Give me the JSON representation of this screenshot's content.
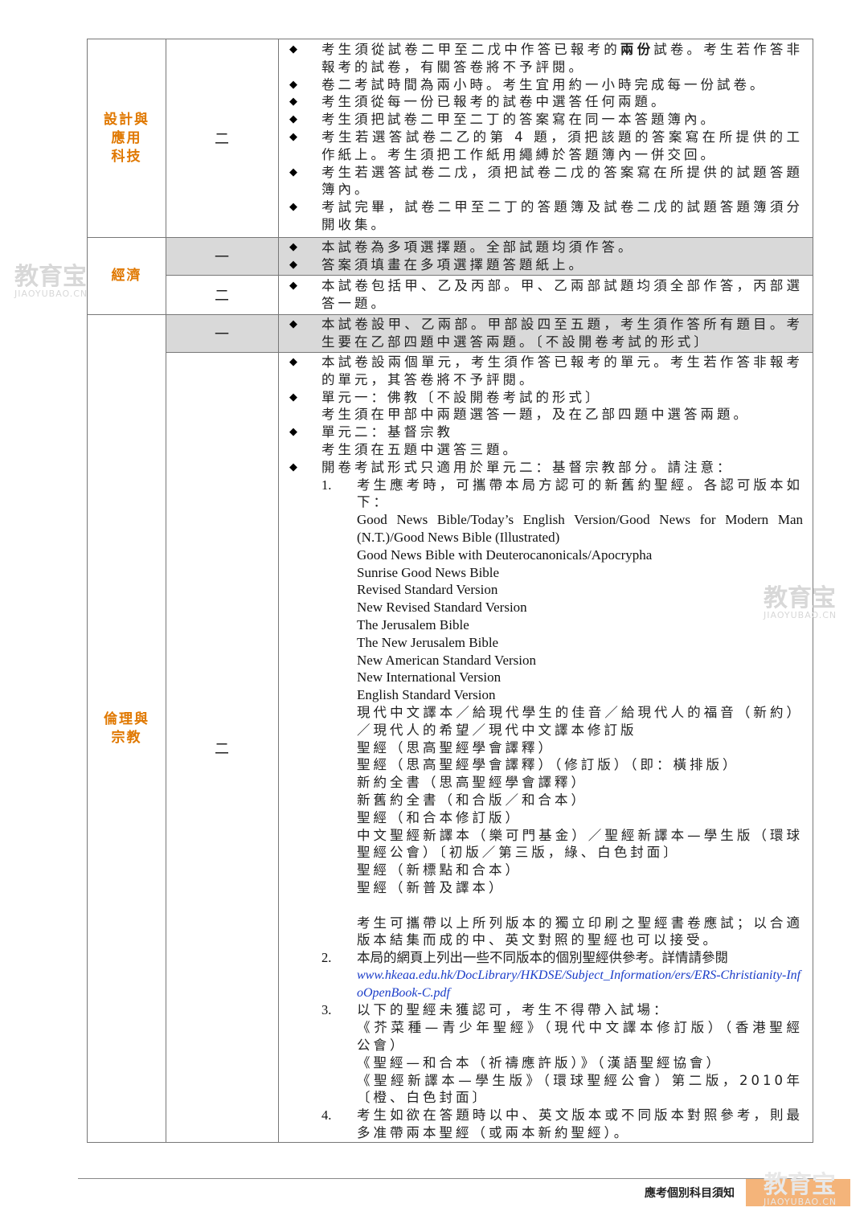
{
  "rows": {
    "design": {
      "subject": "設計與\n應用\n科技",
      "paper": "二",
      "items": [
        "考生須從試卷二甲至二戊中作答已報考的兩份試卷。考生若作答非報考的試卷，有關答卷將不予評閱。",
        "卷二考試時間為兩小時。考生宜用約一小時完成每一份試卷。",
        "考生須從每一份已報考的試卷中選答任何兩題。",
        "考生須把試卷二甲至二丁的答案寫在同一本答題簿內。",
        "考生若選答試卷二乙的第 4 題，須把該題的答案寫在所提供的工作紙上。考生須把工作紙用繩縛於答題簿內一併交回。",
        "考生若選答試卷二戊，須把試卷二戊的答案寫在所提供的試題答題簿內。",
        "考試完畢，試卷二甲至二丁的答題簿及試卷二戊的試題答題簿須分開收集。"
      ]
    },
    "econ": {
      "subject": "經濟",
      "p1": {
        "paper": "一",
        "items": [
          "本試卷為多項選擇題。全部試題均須作答。",
          "答案須填畫在多項選擇題答題紙上。"
        ]
      },
      "p2": {
        "paper": "二",
        "items": [
          "本試卷包括甲、乙及丙部。甲、乙兩部試題均須全部作答，丙部選答一題。"
        ]
      }
    },
    "ethics": {
      "subject": "倫理與\n宗教",
      "p1": {
        "paper": "一",
        "items": [
          "本試卷設甲、乙兩部。甲部設四至五題，考生須作答所有題目。考生要在乙部四題中選答兩題。〔不設開卷考試的形式〕"
        ]
      },
      "p2": {
        "paper": "二",
        "items": [
          "本試卷設兩個單元，考生須作答已報考的單元。考生若作答非報考的單元，其答卷將不予評閱。",
          "單元一：佛教〔不設開卷考試的形式〕\n考生須在甲部中兩題選答一題，及在乙部四題中選答兩題。",
          "單元二：基督宗教\n考生須在五題中選答三題。",
          "開卷考試形式只適用於單元二：基督宗教部分。請注意："
        ],
        "n1_intro": "考生應考時，可攜帶本局方認可的新舊約聖經。各認可版本如下：",
        "bibles_en": [
          "Good News Bible/Today’s English Version/Good News for Modern Man (N.T.)/Good News Bible (Illustrated)",
          "Good News Bible with Deuterocanonicals/Apocrypha",
          "Sunrise Good News Bible",
          "Revised Standard Version",
          "New Revised Standard Version",
          "The Jerusalem Bible",
          "The New Jerusalem Bible",
          "New American Standard Version",
          "New International Version",
          "English Standard Version"
        ],
        "bibles_zh": [
          "現代中文譯本／給現代學生的佳音／給現代人的福音（新約）／現代人的希望／現代中文譯本修訂版",
          "聖經（思高聖經學會譯釋）",
          "聖經（思高聖經學會譯釋）（修訂版）（即：橫排版）",
          "新約全書（思高聖經學會譯釋）",
          "新舊約全書（和合版／和合本）",
          "聖經（和合本修訂版）",
          "中文聖經新譯本（樂可門基金）／聖經新譯本—學生版（環球聖經公會）〔初版／第三版，綠、白色封面〕",
          "聖經（新標點和合本）",
          "聖經（新普及譯本）"
        ],
        "n1_note": "考生可攜帶以上所列版本的獨立印刷之聖經書卷應試；以合適版本結集而成的中、英文對照的聖經也可以接受。",
        "n2_text": "本局的網頁上列出一些不同版本的個別聖經供參考。詳情請參閱",
        "n2_link": "www.hkeaa.edu.hk/DocLibrary/HKDSE/Subject_Information/ers/ERS-Christianity-InfoOpenBook-C.pdf",
        "n3_text": "以下的聖經未獲認可，考生不得帶入試場：",
        "n3_items": [
          "《芥菜種—青少年聖經》（現代中文譯本修訂版）（香港聖經公會）",
          "《聖經—和合本（祈禱應許版）》（漢語聖經協會）",
          "《聖經新譯本—學生版》（環球聖經公會）第二版，2010年〔橙、白色封面〕"
        ],
        "n4_text": "考生如欲在答題時以中、英文版本或不同版本對照參考，則最多准帶兩本聖經（或兩本新約聖經）。",
        "nums": [
          "1.",
          "2.",
          "3.",
          "4."
        ]
      }
    }
  },
  "footer": "應考個別科目須知",
  "watermark": {
    "cn": "教育宝",
    "en": "JIAOYUBAO.CN"
  },
  "colors": {
    "subject": "#e07800",
    "shade": "#d9d9d9",
    "link": "#1a3cc8",
    "footer_bar": "#f4b47a"
  }
}
